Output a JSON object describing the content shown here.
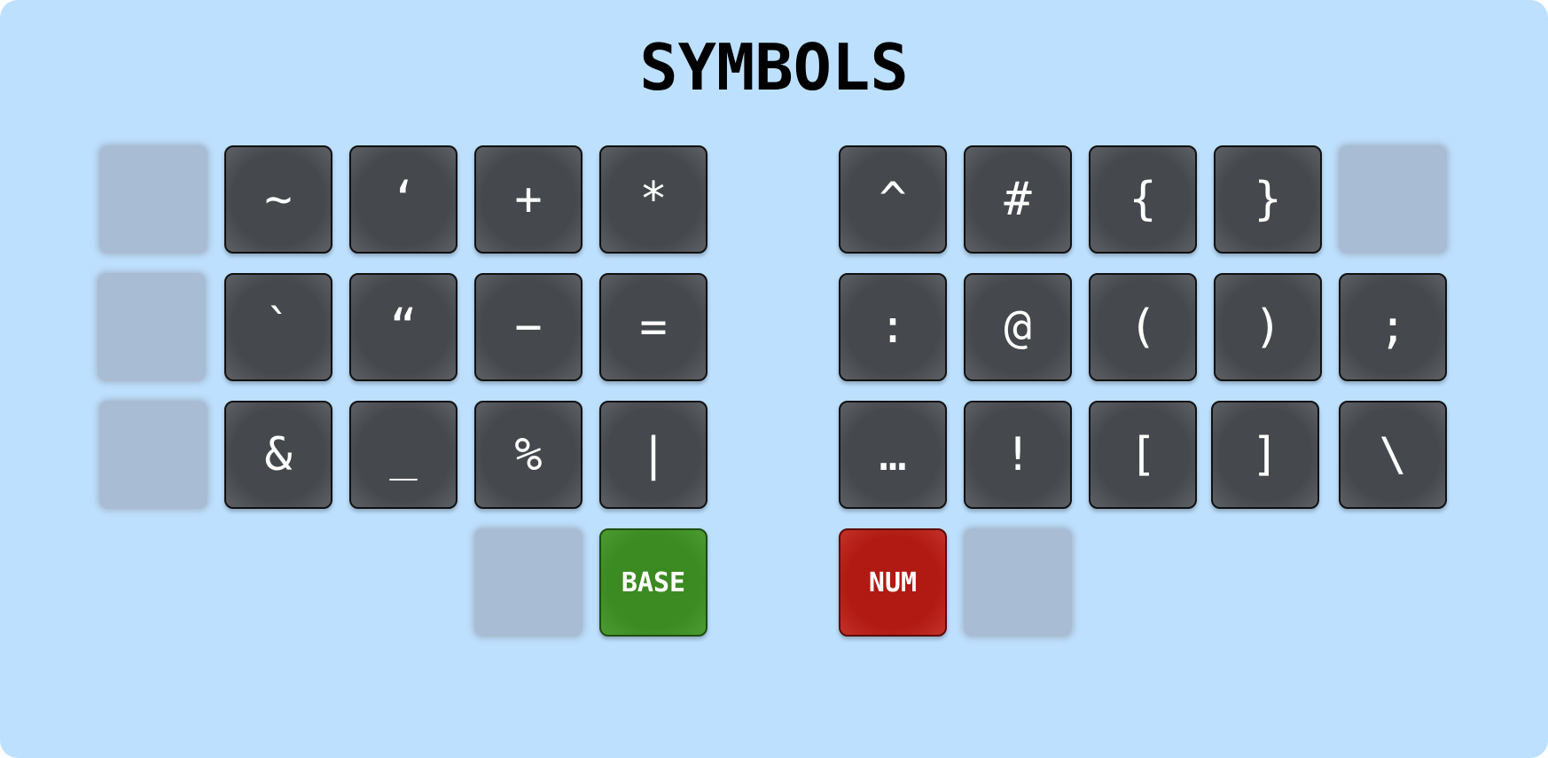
{
  "layer": {
    "title": "SYMBOLS"
  },
  "left_hand": {
    "row1": [
      "~",
      "‘",
      "+",
      "*"
    ],
    "row2": [
      "`",
      "“",
      "−",
      "="
    ],
    "row3": [
      "&",
      "_",
      "%",
      "|"
    ],
    "thumb": [
      "BASE"
    ]
  },
  "right_hand": {
    "row1": [
      "^",
      "#",
      "{",
      "}"
    ],
    "row2": [
      ":",
      "@",
      "(",
      ")",
      ";"
    ],
    "row3": [
      "…",
      "!",
      "[",
      "]",
      "\\"
    ],
    "thumb": [
      "NUM"
    ]
  },
  "colors": {
    "background": "#bde0fe",
    "key": "#45484c",
    "empty_key": "#a8bdd3",
    "base_key": "#3c8a22",
    "num_key": "#b01a12"
  }
}
